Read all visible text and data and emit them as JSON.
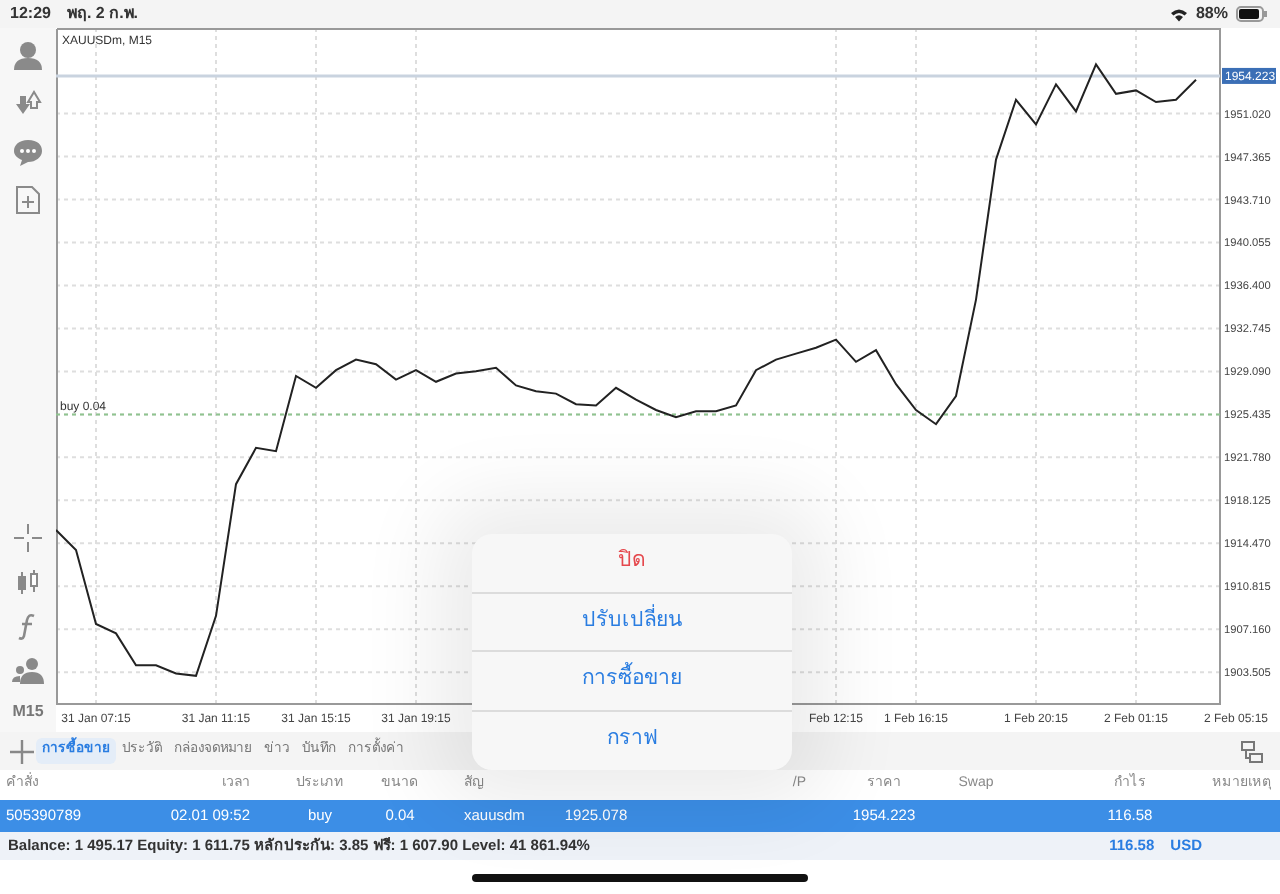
{
  "status_bar": {
    "time": "12:29",
    "date": "พฤ. 2 ก.พ.",
    "battery": "88%"
  },
  "chart": {
    "timeframe": "M15",
    "chart_data": {
      "type": "line",
      "title": "XAUUSDm, M15",
      "grid": true,
      "categories": [
        null,
        null,
        "31 Jan 07:15",
        null,
        null,
        null,
        null,
        null,
        "31 Jan 11:15",
        null,
        null,
        null,
        null,
        "31 Jan 15:15",
        null,
        null,
        null,
        null,
        "31 Jan 19:15",
        null,
        null,
        null,
        null,
        null,
        null,
        null,
        null,
        null,
        null,
        null,
        null,
        null,
        null,
        null,
        null,
        null,
        null,
        null,
        null,
        "Feb 12:15",
        null,
        null,
        null,
        "1 Feb 16:15",
        null,
        null,
        null,
        null,
        null,
        "1 Feb 20:15",
        null,
        null,
        null,
        null,
        "2 Feb 01:15",
        null,
        null,
        null,
        null,
        "2 Feb 05:15"
      ],
      "series": [
        {
          "color": "#222222",
          "values": [
            1915.6,
            1913.9,
            1907.6,
            1906.8,
            1904.1,
            1904.1,
            1903.4,
            1903.2,
            1908.3,
            1919.5,
            1922.6,
            1922.3,
            1928.7,
            1927.7,
            1929.2,
            1930.1,
            1929.7,
            1928.4,
            1929.2,
            1928.2,
            1928.9,
            1929.1,
            1929.4,
            1927.9,
            1927.4,
            1927.2,
            1926.3,
            1926.2,
            1927.7,
            1926.7,
            1925.8,
            1925.2,
            1925.7,
            1925.7,
            1926.2,
            1929.2,
            1930.1,
            1930.6,
            1931.1,
            1931.8,
            1929.9,
            1930.9,
            1928.0,
            1925.8,
            1924.6,
            1927.0,
            1935.2,
            1947.1,
            1952.2,
            1950.1,
            1953.5,
            1951.2,
            1955.2,
            1952.7,
            1953.0,
            1952.0,
            1952.2,
            1953.9,
            null,
            null
          ]
        }
      ],
      "ylim": [
        1900.8,
        1958.3
      ],
      "yticks": [
        {
          "value": 1951.02,
          "label": "1951.020"
        },
        {
          "value": 1947.365,
          "label": "1947.365"
        },
        {
          "value": 1943.71,
          "label": "1943.710"
        },
        {
          "value": 1940.055,
          "label": "1940.055"
        },
        {
          "value": 1936.4,
          "label": "1936.400"
        },
        {
          "value": 1932.745,
          "label": "1932.745"
        },
        {
          "value": 1929.09,
          "label": "1929.090"
        },
        {
          "value": 1925.435,
          "label": "1925.435"
        },
        {
          "value": 1921.78,
          "label": "1921.780"
        },
        {
          "value": 1918.125,
          "label": "1918.125"
        },
        {
          "value": 1914.47,
          "label": "1914.470"
        },
        {
          "value": 1910.815,
          "label": "1910.815"
        },
        {
          "value": 1907.16,
          "label": "1907.160"
        },
        {
          "value": 1903.505,
          "label": "1903.505"
        }
      ],
      "ref_lines": [
        {
          "axis": "y",
          "value": 1954.223,
          "label": "1954.223"
        },
        {
          "axis": "y",
          "value": 1925.435,
          "label": "buy 0.04"
        }
      ]
    }
  },
  "tabs": [
    {
      "label": "การซื้อขาย",
      "selected": true
    },
    {
      "label": "ประวัติ",
      "selected": false
    },
    {
      "label": "กล่องจดหมาย",
      "selected": false
    },
    {
      "label": "ข่าว",
      "selected": false
    },
    {
      "label": "บันทึก",
      "selected": false
    },
    {
      "label": "การตั้งค่า",
      "selected": false
    }
  ],
  "table": {
    "columns": [
      "คำสั่ง",
      "เวลา",
      "ประเภท",
      "ขนาด",
      "สัญ",
      "",
      "",
      "/P",
      "ราคา",
      "Swap",
      "กำไร",
      "หมายเหตุ"
    ],
    "rows": [
      {
        "selected": true,
        "cells": [
          "505390789",
          "02.01 09:52",
          "buy",
          "0.04",
          "xauusdm",
          "1925.078",
          "",
          "",
          "1954.223",
          "",
          "116.58"
        ]
      }
    ]
  },
  "summary": {
    "text": "Balance: 1 495.17 Equity: 1 611.75 หลักประกัน: 3.85 ฟรี: 1 607.90 Level: 41 861.94%",
    "profit": "116.58",
    "currency": "USD"
  },
  "action_sheet": {
    "items": [
      {
        "label": "ปิด",
        "kind": "destructive"
      },
      {
        "label": "ปรับเปลี่ยน",
        "kind": "default"
      },
      {
        "label": "การซื้อขาย",
        "kind": "default"
      },
      {
        "label": "กราฟ",
        "kind": "default"
      }
    ]
  }
}
